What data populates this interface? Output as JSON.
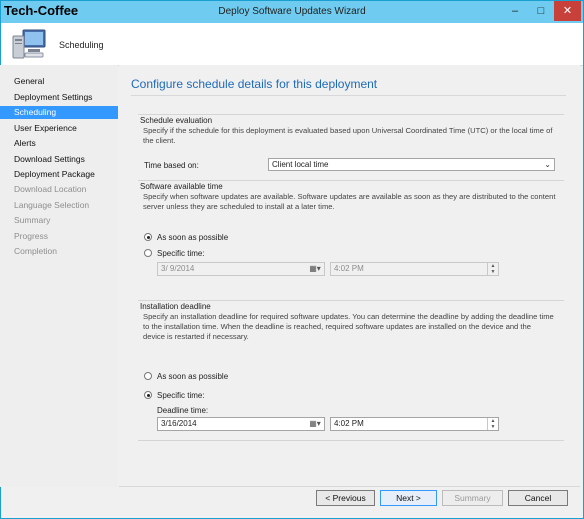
{
  "window": {
    "brand": "Tech-Coffee",
    "title": "Deploy Software Updates Wizard",
    "controls": {
      "minimize": "–",
      "maximize": "□",
      "close": "✕"
    }
  },
  "header": {
    "page_label": "Scheduling",
    "icon": "computer-icon"
  },
  "nav": {
    "items": [
      {
        "label": "General",
        "state": "done"
      },
      {
        "label": "Deployment Settings",
        "state": "done"
      },
      {
        "label": "Scheduling",
        "state": "active"
      },
      {
        "label": "User Experience",
        "state": "done"
      },
      {
        "label": "Alerts",
        "state": "done"
      },
      {
        "label": "Download Settings",
        "state": "done"
      },
      {
        "label": "Deployment Package",
        "state": "done"
      },
      {
        "label": "Download Location",
        "state": "disabled"
      },
      {
        "label": "Language Selection",
        "state": "disabled"
      },
      {
        "label": "Summary",
        "state": "disabled"
      },
      {
        "label": "Progress",
        "state": "disabled"
      },
      {
        "label": "Completion",
        "state": "disabled"
      }
    ]
  },
  "main": {
    "heading": "Configure schedule details for this deployment",
    "schedule_evaluation": {
      "title": "Schedule evaluation",
      "description_line1": "Specify if the schedule for this deployment is evaluated based upon Universal Coordinated Time (UTC) or the local time of",
      "description_line2": "the client.",
      "time_based_label": "Time based on:",
      "time_based_value": "Client local time"
    },
    "software_available": {
      "title": "Software available time",
      "description_line1": "Specify when software updates are available. Software updates are available as soon as they are distributed to the content",
      "description_line2": "server unless they are scheduled to install at a later time.",
      "asap_label": "As soon as possible",
      "asap_selected": true,
      "specific_label": "Specific time:",
      "date_value": "3/  9/2014",
      "time_value": "4:02 PM"
    },
    "installation_deadline": {
      "title": "Installation deadline",
      "description_line1": "Specify an installation deadline for required software updates. You can determine the deadline by adding the deadline time",
      "description_line2": "to the installation time. When the deadline is reached, required software updates are installed on the device and the",
      "description_line3": "device is restarted if necessary.",
      "asap_label": "As soon as possible",
      "specific_label": "Specific time:",
      "specific_selected": true,
      "deadline_label": "Deadline time:",
      "date_value": "3/16/2014",
      "time_value": "4:02 PM"
    }
  },
  "buttons": {
    "previous": "< Previous",
    "next": "Next >",
    "summary": "Summary",
    "cancel": "Cancel"
  }
}
